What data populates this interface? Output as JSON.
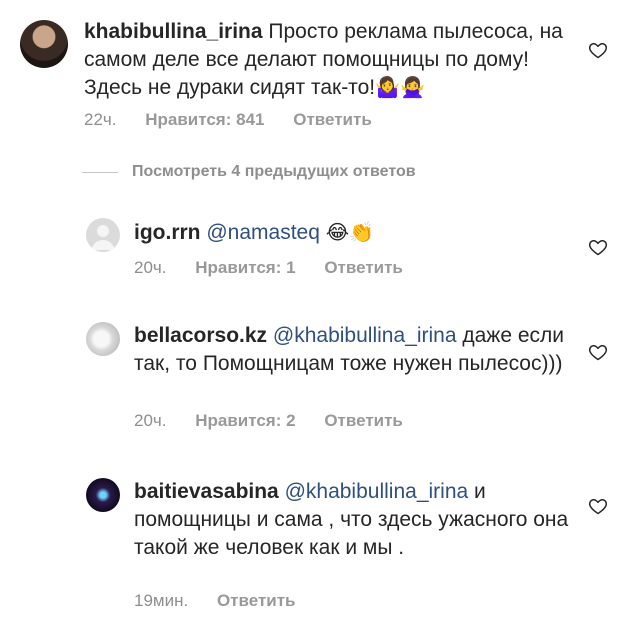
{
  "comments": [
    {
      "username": "khabibullina_irina",
      "text": "Просто реклама пылесоса, на самом деле все делают помощницы по дому! Здесь не дураки сидят так-то!",
      "emojis": "🤷‍♀️🙅‍♀️",
      "time": "22ч.",
      "likes": "Нравится: 841",
      "reply": "Ответить"
    },
    {
      "username": "igo.rrn",
      "mention": "@namasteq",
      "text": "",
      "emojis": "😂👏",
      "time": "20ч.",
      "likes": "Нравится: 1",
      "reply": "Ответить"
    },
    {
      "username": "bellacorso.kz",
      "mention": "@khabibullina_irina",
      "text": "даже если так, то Помощницам тоже нужен пылесос)))",
      "time": "20ч.",
      "likes": "Нравится: 2",
      "reply": "Ответить"
    },
    {
      "username": "baitievasabina",
      "mention": "@khabibullina_irina",
      "text": "и помощницы и сама , что здесь ужасного она такой же человек как и мы .",
      "time": "19мин.",
      "reply": "Ответить"
    }
  ],
  "view_replies": "Посмотреть 4 предыдущих ответов",
  "colors": {
    "text": "#262626",
    "meta": "#8e8e8e",
    "mention": "#2f4f7f",
    "background": "#ffffff"
  },
  "icons": {
    "like": "heart-outline-icon"
  }
}
